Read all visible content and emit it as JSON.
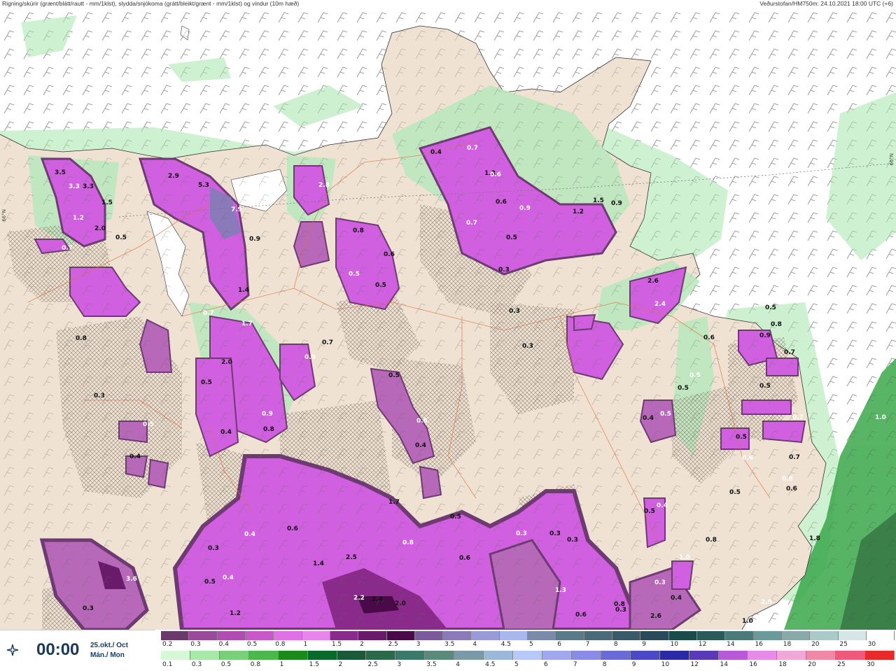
{
  "header": {
    "title": "Rigning/skúrir (grænt/blátt/rautt - mm/1klst), slydda/snjókoma (grátt/bleikt/grænt - mm/1klst) og vindur (10m hæð)",
    "source": "Veðurstofan/HM750m: 24.10.2021 18:00 UTC (+6)"
  },
  "map": {
    "lat_label": "66°N",
    "colors": {
      "land": "#efe2d3",
      "sea": "#ffffff",
      "rain_light": "#c8f0cc",
      "rain_mid": "#8fd89a",
      "snow_light": "#b868b8",
      "snow_mid": "#d060e0",
      "snow_dark": "#6e3a72",
      "roads": "#e07040"
    },
    "values": [
      {
        "t": "3.5"
      },
      {
        "t": "3.3"
      },
      {
        "t": "3.3"
      },
      {
        "t": "1.5"
      },
      {
        "t": "1.2"
      },
      {
        "t": "2.0"
      },
      {
        "t": "0.5"
      },
      {
        "t": "0.7"
      },
      {
        "t": "2.9"
      },
      {
        "t": "5.3"
      },
      {
        "t": "7.9"
      },
      {
        "t": "1.4"
      },
      {
        "t": "0.9"
      },
      {
        "t": "2.8"
      },
      {
        "t": "0.8"
      },
      {
        "t": "0.6"
      },
      {
        "t": "0.5"
      },
      {
        "t": "0.5"
      },
      {
        "t": "0.4"
      },
      {
        "t": "0.7"
      },
      {
        "t": "1.3"
      },
      {
        "t": "0.6"
      },
      {
        "t": "0.9"
      },
      {
        "t": "1.2"
      },
      {
        "t": "1.5"
      },
      {
        "t": "0.7"
      },
      {
        "t": "0.5"
      },
      {
        "t": "0.3"
      },
      {
        "t": "0.6"
      },
      {
        "t": "0.9"
      },
      {
        "t": "2.6"
      },
      {
        "t": "2.4"
      },
      {
        "t": "0.3"
      },
      {
        "t": "0.3"
      },
      {
        "t": "1.7"
      },
      {
        "t": "2.0"
      },
      {
        "t": "0.5"
      },
      {
        "t": "0.9"
      },
      {
        "t": "0.7"
      },
      {
        "t": "0.5"
      },
      {
        "t": "0.6"
      },
      {
        "t": "0.4"
      },
      {
        "t": "0.8"
      },
      {
        "t": "0.9"
      },
      {
        "t": "0.4"
      },
      {
        "t": "0.4"
      },
      {
        "t": "0.5"
      },
      {
        "t": "0.3"
      },
      {
        "t": "0.8"
      },
      {
        "t": "0.7"
      },
      {
        "t": "1.7"
      },
      {
        "t": "0.6"
      },
      {
        "t": "0.4"
      },
      {
        "t": "0.3"
      },
      {
        "t": "0.5"
      },
      {
        "t": "0.4"
      },
      {
        "t": "1.4"
      },
      {
        "t": "2.5"
      },
      {
        "t": "2.2"
      },
      {
        "t": "2.4"
      },
      {
        "t": "2.0"
      },
      {
        "t": "0.8"
      },
      {
        "t": "0.5"
      },
      {
        "t": "0.6"
      },
      {
        "t": "0.3"
      },
      {
        "t": "0.3"
      },
      {
        "t": "0.3"
      },
      {
        "t": "1.3"
      },
      {
        "t": "0.6"
      },
      {
        "t": "0.8"
      },
      {
        "t": "3.6"
      },
      {
        "t": "0.3"
      },
      {
        "t": "1.2"
      },
      {
        "t": "0.5"
      },
      {
        "t": "0.4"
      },
      {
        "t": "0.5"
      },
      {
        "t": "0.6"
      },
      {
        "t": "0.7"
      },
      {
        "t": "0.5"
      },
      {
        "t": "0.7"
      },
      {
        "t": "0.5"
      },
      {
        "t": "0.5"
      },
      {
        "t": "1.0"
      },
      {
        "t": "1.8"
      },
      {
        "t": "1.0"
      },
      {
        "t": "2.8"
      },
      {
        "t": "0.5"
      },
      {
        "t": "0.8"
      },
      {
        "t": "0.4"
      },
      {
        "t": "0.5"
      },
      {
        "t": "2.6"
      },
      {
        "t": "1.0"
      },
      {
        "t": "0.9"
      },
      {
        "t": "0.6"
      },
      {
        "t": "0.5"
      },
      {
        "t": "0.8"
      },
      {
        "t": "0.7"
      },
      {
        "t": "0.3"
      },
      {
        "t": "0.4"
      },
      {
        "t": "0.3"
      },
      {
        "t": "0.8"
      },
      {
        "t": "0.6"
      }
    ]
  },
  "footer": {
    "time": "00:00",
    "date_line1": "25.okt./ Oct",
    "date_line2": "Mán./ Mon",
    "snow_scale": {
      "labels": [
        "0.2",
        "0.3",
        "0.4",
        "0.5",
        "0.8",
        "1",
        "1.5",
        "2",
        "2.5",
        "3",
        "3.5",
        "4",
        "4.5",
        "5",
        "6",
        "7",
        "8",
        "9",
        "10",
        "12",
        "14",
        "16",
        "18",
        "20",
        "25",
        "30"
      ],
      "colors": [
        "#6a3a6a",
        "#9a4a9a",
        "#b04cb4",
        "#c858c8",
        "#e070e6",
        "#e884ee",
        "#8a2a8a",
        "#6a1a6a",
        "#4a0a4a",
        "#7a5a9a",
        "#8a7aba",
        "#9a9ad8",
        "#a8b8ee",
        "#7a8aa8",
        "#5a7a8a",
        "#4a6a7a",
        "#3a5a6a",
        "#2a4a5a",
        "#1a4a4a",
        "#2a5a5a",
        "#4a7a7a",
        "#6a9a9a",
        "#8aaaaa",
        "#aacaca",
        "#d6e6e6",
        "#ffffff"
      ]
    },
    "rain_scale": {
      "labels": [
        "0.1",
        "0.3",
        "0.5",
        "0.8",
        "1",
        "1.5",
        "2",
        "2.5",
        "3",
        "3.5",
        "4",
        "4.5",
        "5",
        "6",
        "7",
        "8",
        "9",
        "10",
        "12",
        "14",
        "16",
        "18",
        "20",
        "25",
        "30"
      ],
      "colors": [
        "#d6f8d6",
        "#a8e8a8",
        "#7ad07a",
        "#4ab84a",
        "#1a8a1a",
        "#0a6a2a",
        "#1a5a3a",
        "#2a6a4a",
        "#3a7a6a",
        "#5a8a7a",
        "#7a9aa8",
        "#9ab8d8",
        "#b8c8f8",
        "#a0a8f0",
        "#8a8ae8",
        "#6a6ad8",
        "#4a4ac8",
        "#2a2aa8",
        "#5a3ab8",
        "#b85ad8",
        "#e88ae8",
        "#f0a8d8",
        "#f088a8",
        "#f05a7a",
        "#e82a2a"
      ]
    }
  }
}
